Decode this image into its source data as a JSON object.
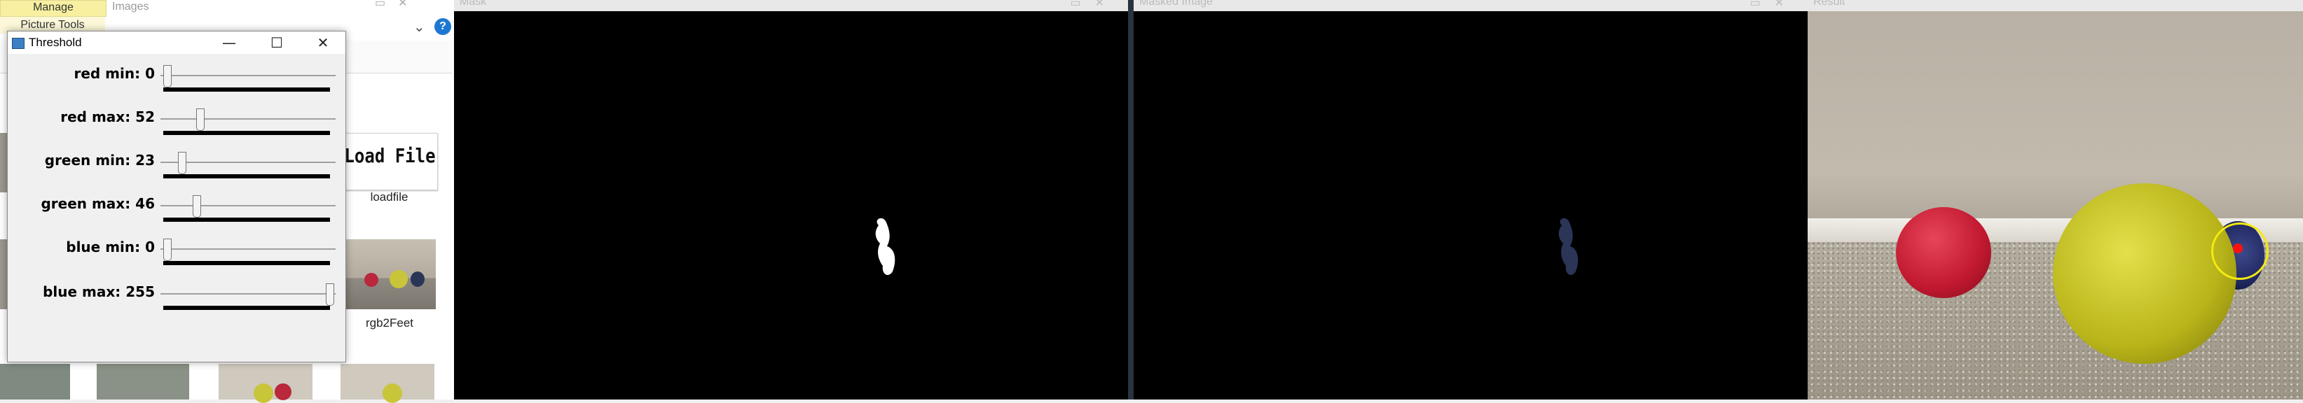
{
  "explorer": {
    "ribbon_tab_manage": "Manage",
    "ribbon_tab_images": "Images",
    "picture_tools": "Picture Tools",
    "load_file_button_label": "Load File",
    "load_file_caption": "loadfile",
    "rgb_caption": "rgb2Feet"
  },
  "threshold_window": {
    "title": "Threshold",
    "sliders": [
      {
        "label": "red min: 0",
        "value": 0,
        "max": 255
      },
      {
        "label": "red max: 52",
        "value": 52,
        "max": 255
      },
      {
        "label": "green min: 23",
        "value": 23,
        "max": 255
      },
      {
        "label": "green max: 46",
        "value": 46,
        "max": 255
      },
      {
        "label": "blue min: 0",
        "value": 0,
        "max": 255
      },
      {
        "label": "blue max: 255",
        "value": 255,
        "max": 255
      }
    ]
  },
  "windows": {
    "mask_title": "Mask",
    "masked_title": "Masked Image",
    "result_title": "Result"
  },
  "colors": {
    "mask_background": "#000000",
    "mask_blob": "#ffffff",
    "masked_blob": "#2a3558",
    "detection_circle": "#f4ea10",
    "detection_center": "#ff1010"
  }
}
